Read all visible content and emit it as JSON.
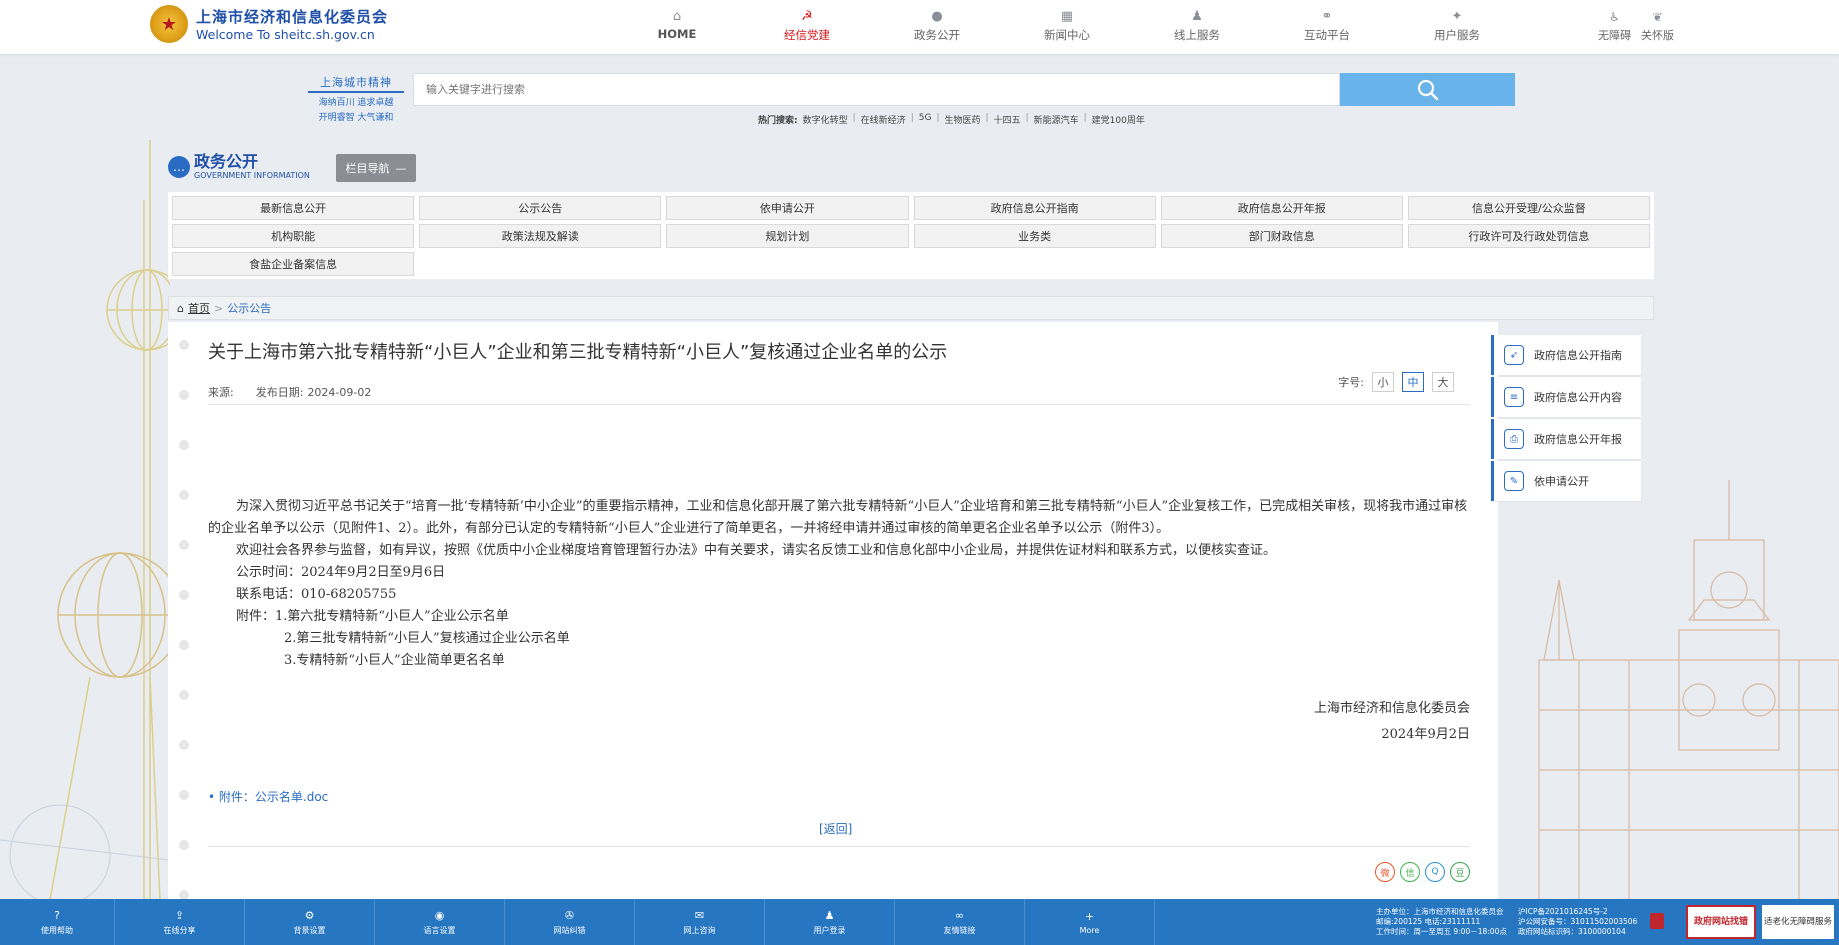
{
  "header": {
    "site_name_cn": "上海市经济和信息化委员会",
    "site_name_en": "Welcome To sheitc.sh.gov.cn",
    "nav": [
      {
        "label": "HOME",
        "icon": "home-icon"
      },
      {
        "label": "经信党建",
        "icon": "party-icon"
      },
      {
        "label": "政务公开",
        "icon": "chat-icon"
      },
      {
        "label": "新闻中心",
        "icon": "news-icon"
      },
      {
        "label": "线上服务",
        "icon": "user-icon"
      },
      {
        "label": "互动平台",
        "icon": "interact-icon"
      },
      {
        "label": "用户服务",
        "icon": "service-icon"
      }
    ],
    "access": [
      {
        "label": "无障碍",
        "icon": "accessibility-icon"
      },
      {
        "label": "关怀版",
        "icon": "care-icon"
      }
    ]
  },
  "spirit": {
    "title": "上海城市精神",
    "line1": "海纳百川 追求卓越",
    "line2": "开明睿智 大气谦和"
  },
  "search": {
    "placeholder": "输入关键字进行搜索",
    "hot_label": "热门搜索:",
    "hot": [
      "数字化转型",
      "在线新经济",
      "5G",
      "生物医药",
      "十四五",
      "新能源汽车",
      "建党100周年"
    ]
  },
  "section": {
    "title_cn": "政务公开",
    "title_en": "GOVERNMENT INFORMATION",
    "nav_toggle": "栏目导航"
  },
  "categories": [
    "最新信息公开",
    "公示公告",
    "依申请公开",
    "政府信息公开指南",
    "政府信息公开年报",
    "信息公开受理/公众监督",
    "机构职能",
    "政策法规及解读",
    "规划计划",
    "业务类",
    "部门财政信息",
    "行政许可及行政处罚信息",
    "食盐企业备案信息"
  ],
  "breadcrumb": {
    "home": "首页",
    "sep": ">",
    "current": "公示公告"
  },
  "article": {
    "title": "关于上海市第六批专精特新“小巨人”企业和第三批专精特新“小巨人”复核通过企业名单的公示",
    "source_label": "来源:",
    "date_label": "发布日期:",
    "date": "2024-09-02",
    "fontsize_label": "字号:",
    "fontsizes": [
      "小",
      "中",
      "大"
    ],
    "para1": "为深入贯彻习近平总书记关于“培育一批‘专精特新’中小企业”的重要指示精神，工业和信息化部开展了第六批专精特新“小巨人”企业培育和第三批专精特新“小巨人”企业复核工作，已完成相关审核，现将我市通过审核的企业名单予以公示（见附件1、2）。此外，有部分已认定的专精特新“小巨人”企业进行了简单更名，一并将经申请并通过审核的简单更名企业名单予以公示（附件3）。",
    "para2": "欢迎社会各界参与监督，如有异议，按照《优质中小企业梯度培育管理暂行办法》中有关要求，请实名反馈工业和信息化部中小企业局，并提供佐证材料和联系方式，以便核实查证。",
    "period": "公示时间：2024年9月2日至9月6日",
    "phone": "联系电话：010-68205755",
    "attach1": "附件：1.第六批专精特新“小巨人”企业公示名单",
    "attach2": "2.第三批专精特新“小巨人”复核通过企业公示名单",
    "attach3": "3.专精特新“小巨人”企业简单更名名单",
    "sign_org": "上海市经济和信息化委员会",
    "sign_date": "2024年9月2日",
    "attachment_link": "• 附件：公示名单.doc",
    "back": "[返回]"
  },
  "share": [
    {
      "label": "微",
      "icon": "weibo-icon",
      "color": "#e8552b"
    },
    {
      "label": "信",
      "icon": "wechat-icon",
      "color": "#3bb54a"
    },
    {
      "label": "Q",
      "icon": "qq-icon",
      "color": "#2a8fd8"
    },
    {
      "label": "豆",
      "icon": "douban-icon",
      "color": "#3aa04a"
    }
  ],
  "side_links": [
    {
      "label": "政府信息公开指南",
      "icon": "compass-icon"
    },
    {
      "label": "政府信息公开内容",
      "icon": "list-icon"
    },
    {
      "label": "政府信息公开年报",
      "icon": "printer-icon"
    },
    {
      "label": "依申请公开",
      "icon": "document-icon"
    }
  ],
  "footer": {
    "buttons": [
      {
        "label": "使用帮助",
        "icon": "help-icon"
      },
      {
        "label": "在线分享",
        "icon": "share-icon"
      },
      {
        "label": "背景设置",
        "icon": "settings-icon"
      },
      {
        "label": "语言设置",
        "icon": "language-icon"
      },
      {
        "label": "网站纠错",
        "icon": "wrench-icon"
      },
      {
        "label": "网上咨询",
        "icon": "message-icon"
      },
      {
        "label": "用户登录",
        "icon": "login-icon"
      },
      {
        "label": "友情链接",
        "icon": "link-icon"
      },
      {
        "label": "More",
        "icon": "plus-icon"
      }
    ],
    "info1": "主办单位：上海市经济和信息化委员会",
    "info2": "邮编:200125 电话:23111111",
    "info3": "工作时间：周一至周五 9:00－18:00点",
    "icp1": "沪ICP备2021016245号-2",
    "icp2": "沪公网安备号：31011502003506",
    "icp3": "政府网站标识码：3100000104",
    "find_error": "政府网站找错",
    "old_version": "适老化无障碍服务"
  }
}
